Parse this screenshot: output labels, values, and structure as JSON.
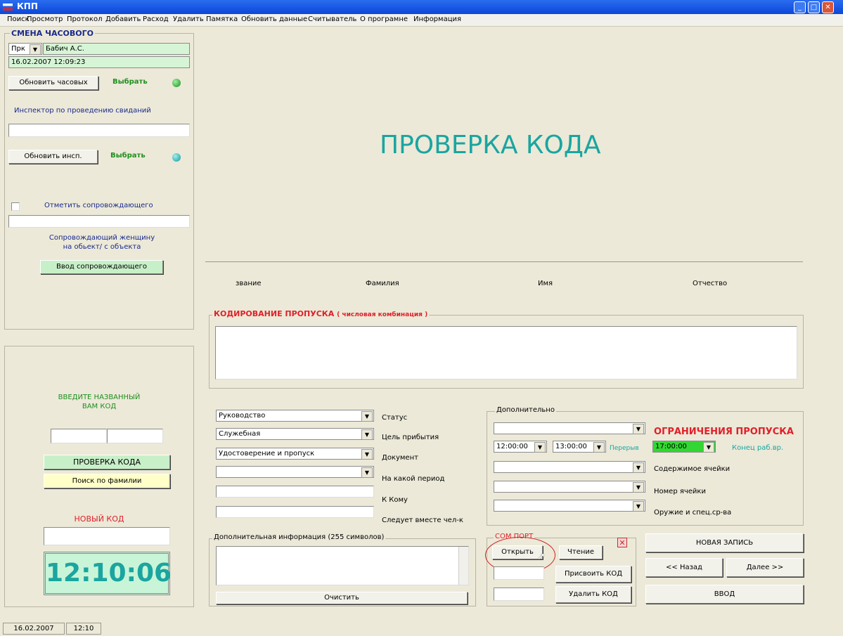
{
  "window": {
    "title": "КПП"
  },
  "menu": [
    "Поиск",
    "Просмотр",
    "Протокол",
    "Добавить",
    "Расход",
    "Удалить",
    "Памятка",
    "Обновить данные",
    "Считыватель",
    "О програмне",
    "Информация"
  ],
  "shift": {
    "title": "СМЕНА ЧАСОВОГО",
    "rank": "Прк",
    "name": "Бабич А.С.",
    "datetime": "16.02.2007 12:09:23",
    "update_btn": "Обновить часовых",
    "choose": "Выбрать",
    "inspector_label": "Инспектор по проведению свиданий",
    "inspector_value": "",
    "update_insp_btn": "Обновить инсп.",
    "choose2": "Выбрать",
    "escort_check": "Отметить сопровождающего",
    "escort_value": "",
    "escort_note1": "Сопровождающий женщину",
    "escort_note2": "на обьект/ с объекта",
    "escort_btn": "Ввод сопровождающего"
  },
  "code_panel": {
    "prompt1": "ВВЕДИТЕ НАЗВАННЫЙ",
    "prompt2": "ВАМ КОД",
    "check_btn": "ПРОВЕРКА КОДА",
    "search_btn": "Поиск по фамилии",
    "new_code": "НОВЫЙ КОД",
    "clock": "12:10:06"
  },
  "main": {
    "heading": "ПРОВЕРКА КОДА",
    "col_rank": "звание",
    "col_surname": "Фамилия",
    "col_name": "Имя",
    "col_patronymic": "Отчество",
    "encoding_title": "КОДИРОВАНИЕ ПРОПУСКА",
    "encoding_sub": "( числовая комбинация )"
  },
  "form": {
    "status_value": "Руководство",
    "status_label": "Статус",
    "purpose_value": "Служебная",
    "purpose_label": "Цель прибытия",
    "doc_value": "Удостоверение и пропуск",
    "doc_label": "Документ",
    "period_label": "На какой период",
    "to_whom_label": "К Кому",
    "with_label": "Следует вместе чел-к",
    "extra_info_title": "Дополнительная  информация (255 символов)",
    "clear_btn": "Очистить"
  },
  "extra": {
    "title": "Дополнительно",
    "restrictions": "ОГРАНИЧЕНИЯ ПРОПУСКА",
    "break_from": "12:00:00",
    "break_to": "13:00:00",
    "break_label": "Перерыв",
    "end_time": "17:00:00",
    "end_label": "Конец раб.вр.",
    "cell_content": "Содержимое ячейки",
    "cell_number": "Номер ячейки",
    "weapons": "Оружие и спец.ср-ва"
  },
  "com": {
    "title": "COM ПОРТ",
    "open_btn": "Открыть",
    "read_btn": "Чтение",
    "assign_btn": "Присвоить КОД",
    "delete_btn": "Удалить КОД"
  },
  "nav": {
    "new_record": "НОВАЯ ЗАПИСЬ",
    "back": "<< Назад",
    "next": "Далее >>",
    "enter": "ВВОД"
  },
  "status": {
    "date": "16.02.2007",
    "time": "12:10"
  },
  "colors": {
    "green_text": "#1f8f1f",
    "red_text": "#e0202a",
    "teal": "#1aa5a0",
    "clock_bg": "#c8f5d8"
  }
}
